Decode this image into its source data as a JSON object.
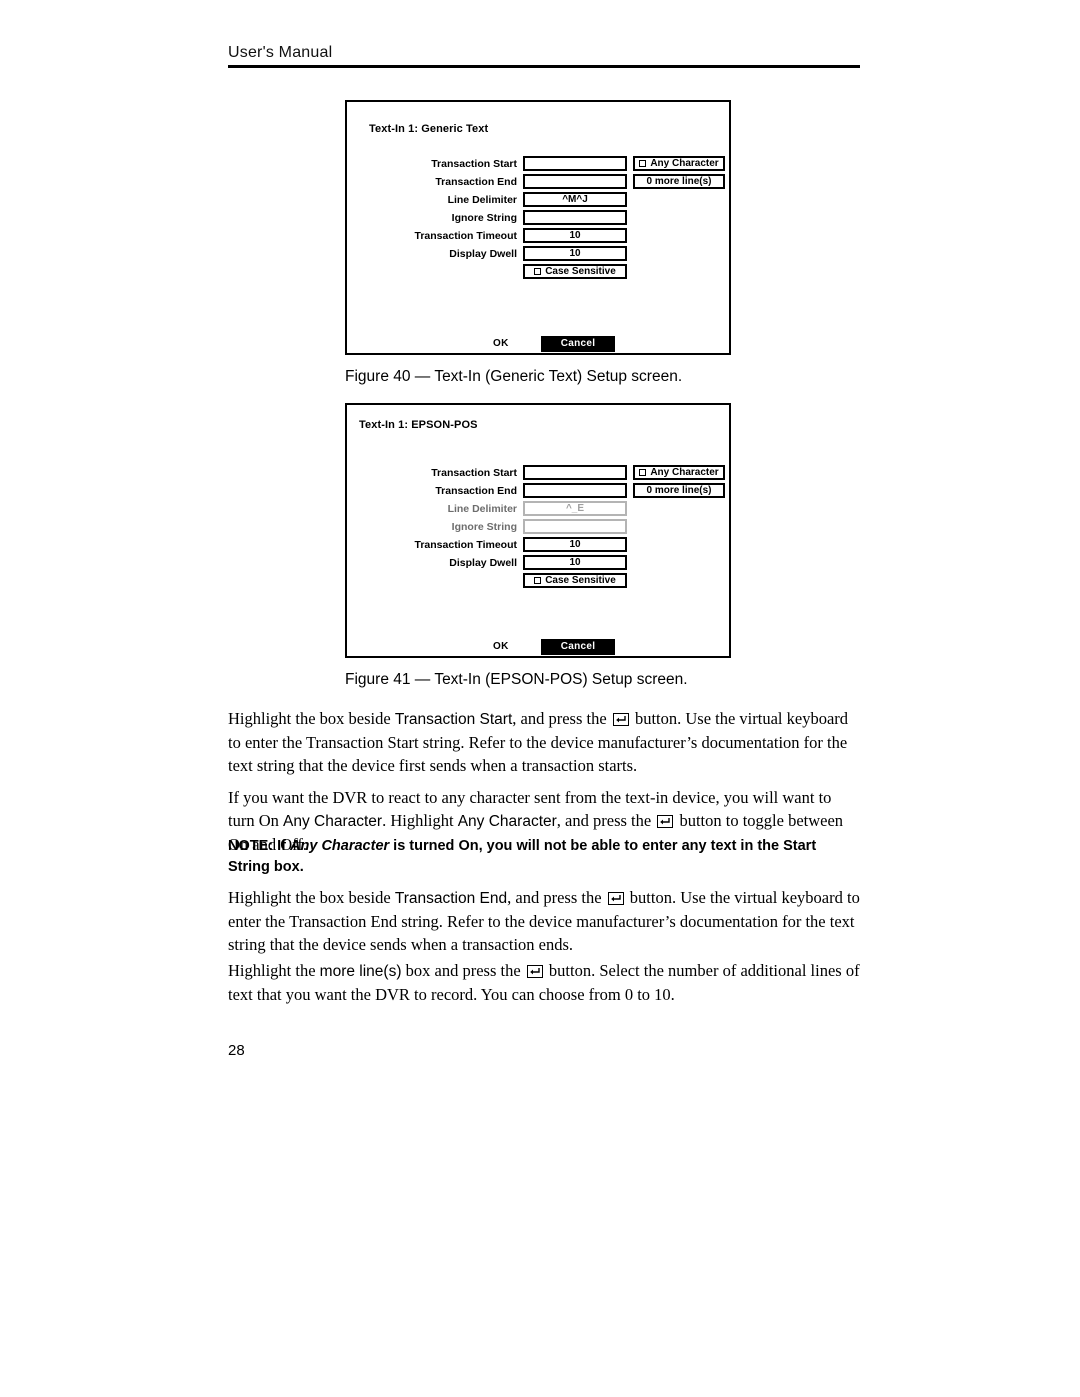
{
  "header": {
    "title": "User's Manual"
  },
  "page_number": "28",
  "figures": [
    {
      "caption": "Figure 40 — Text-In (Generic Text) Setup screen.",
      "dialog": {
        "title": "Text-In 1: Generic Text",
        "fields": [
          {
            "label": "Transaction Start",
            "value": "",
            "disabled": false
          },
          {
            "label": "Transaction End",
            "value": "",
            "disabled": false
          },
          {
            "label": "Line Delimiter",
            "value": "^M^J",
            "disabled": false
          },
          {
            "label": "Ignore String",
            "value": "",
            "disabled": false
          },
          {
            "label": "Transaction Timeout",
            "value": "10",
            "disabled": false
          },
          {
            "label": "Display Dwell",
            "value": "10",
            "disabled": false
          }
        ],
        "any_character": {
          "label": "Any Character",
          "checked": false
        },
        "more_lines": {
          "label": "0 more line(s)"
        },
        "case_sensitive": {
          "label": "Case Sensitive",
          "checked": false
        },
        "ok_label": "OK",
        "cancel_label": "Cancel"
      }
    },
    {
      "caption": "Figure 41 — Text-In (EPSON-POS) Setup screen.",
      "dialog": {
        "title": "Text-In 1: EPSON-POS",
        "fields": [
          {
            "label": "Transaction Start",
            "value": "",
            "disabled": false
          },
          {
            "label": "Transaction End",
            "value": "",
            "disabled": false
          },
          {
            "label": "Line Delimiter",
            "value": "^_E",
            "disabled": true
          },
          {
            "label": "Ignore String",
            "value": "",
            "disabled": true
          },
          {
            "label": "Transaction Timeout",
            "value": "10",
            "disabled": false
          },
          {
            "label": "Display Dwell",
            "value": "10",
            "disabled": false
          }
        ],
        "any_character": {
          "label": "Any Character",
          "checked": false
        },
        "more_lines": {
          "label": "0 more line(s)"
        },
        "case_sensitive": {
          "label": "Case Sensitive",
          "checked": false
        },
        "ok_label": "OK",
        "cancel_label": "Cancel"
      }
    }
  ],
  "body": {
    "p1": {
      "part1": "Highlight the box beside ",
      "ui1": "Transaction Start",
      "part2": ", and press the ",
      "part3": " button.  Use the virtual keyboard to enter the Transaction Start string.  Refer to the device manufacturer’s documentation for the text string that the device first sends when a transaction starts."
    },
    "p2": {
      "part1": "If you want the DVR to react to any character sent from the text-in device, you will want to turn On ",
      "ui1": "Any Character",
      "part2": ".  Highlight ",
      "ui2": "Any Character",
      "part3": ", and press the ",
      "part4": " button to toggle between On and Off."
    },
    "note": {
      "part1": "NOTE:  If ",
      "italic": "Any Character",
      "part2": " is turned On, you will not be able to enter any text in the Start String box."
    },
    "p3": {
      "part1": "Highlight the box beside ",
      "ui1": "Transaction End",
      "part2": ", and press the ",
      "part3": " button.  Use the virtual keyboard to enter the Transaction End string.  Refer to the device manufacturer’s documentation for the text string that the device sends when a transaction ends."
    },
    "p4": {
      "part1": "Highlight the ",
      "ui1": "more line(s)",
      "part2": " box and press the ",
      "part3": " button.  Select the number of additional lines of text that you want the DVR to record.  You can choose from 0 to 10."
    }
  }
}
